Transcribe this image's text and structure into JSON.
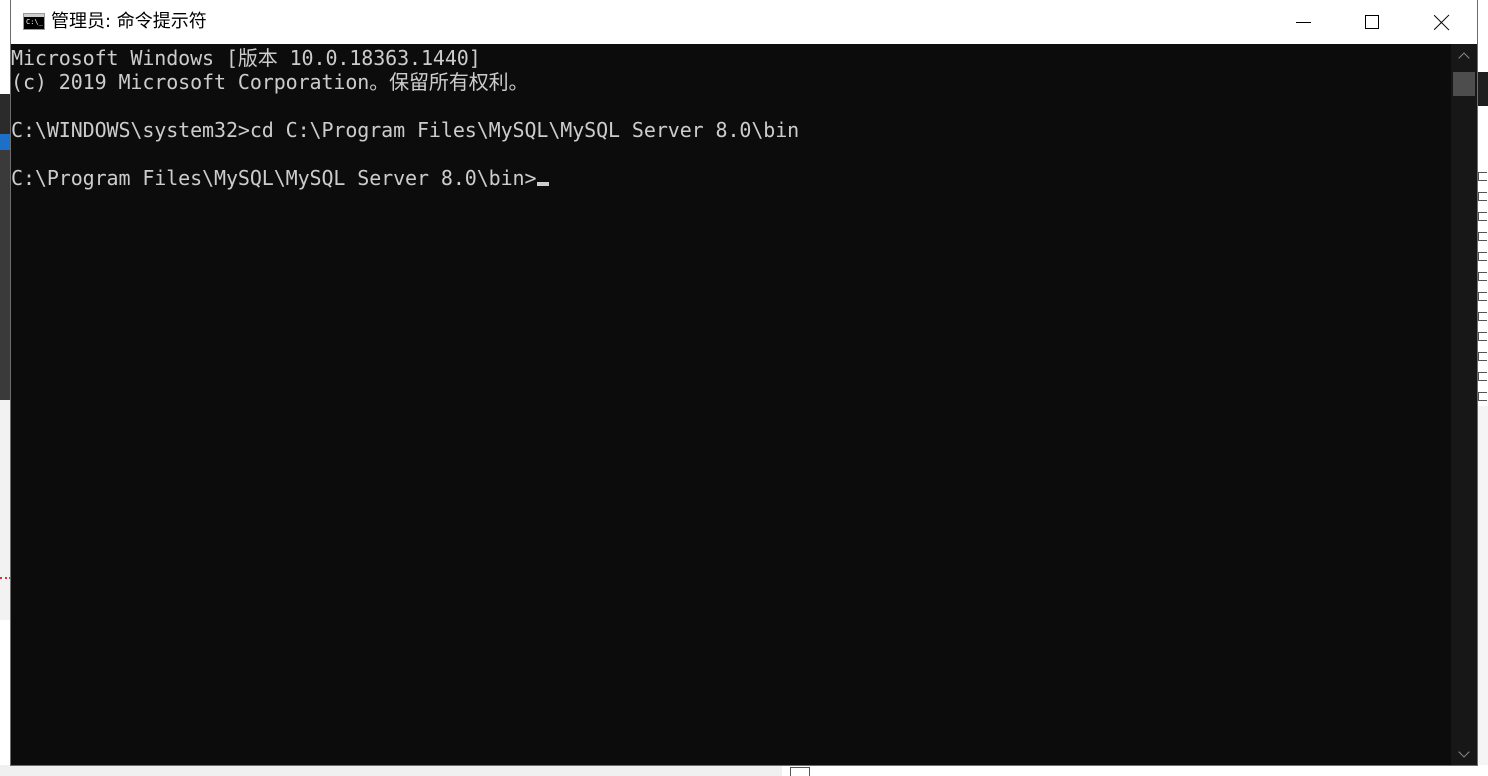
{
  "window": {
    "title": "管理员: 命令提示符",
    "icon_label": "C:\\_",
    "controls": {
      "minimize": "minimize-icon",
      "maximize": "maximize-icon",
      "close": "close-icon"
    }
  },
  "console": {
    "lines": [
      "Microsoft Windows [版本 10.0.18363.1440]",
      "(c) 2019 Microsoft Corporation。保留所有权利。",
      "C:\\WINDOWS\\system32>cd C:\\Program Files\\MySQL\\MySQL Server 8.0\\bin",
      "C:\\Program Files\\MySQL\\MySQL Server 8.0\\bin>"
    ],
    "text_color": "#cccccc",
    "background_color": "#0c0c0c"
  },
  "scrollbar": {
    "position": 0
  }
}
